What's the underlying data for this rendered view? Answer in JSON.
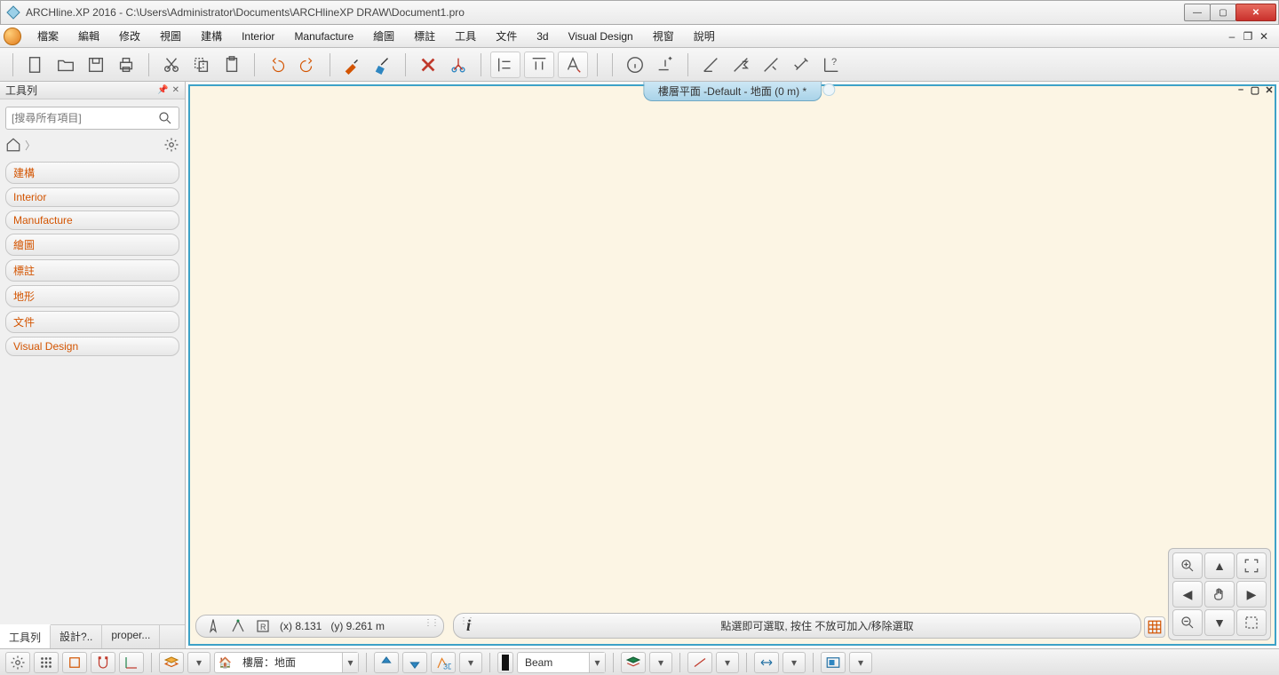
{
  "window": {
    "title": "ARCHline.XP 2016 - C:\\Users\\Administrator\\Documents\\ARCHlineXP DRAW\\Document1.pro"
  },
  "menu": {
    "items": [
      "檔案",
      "編輯",
      "修改",
      "視圖",
      "建構",
      "Interior",
      "Manufacture",
      "繪圖",
      "標註",
      "工具",
      "文件",
      "3d",
      "Visual Design",
      "視窗",
      "說明"
    ]
  },
  "sidebar": {
    "title": "工具列",
    "search_placeholder": "[搜尋所有項目]",
    "categories": [
      "建構",
      "Interior",
      "Manufacture",
      "繪圖",
      "標註",
      "地形",
      "文件",
      "Visual Design"
    ],
    "tabs": [
      "工具列",
      "設計?..",
      "proper..."
    ],
    "active_tab": 0
  },
  "canvas": {
    "tab_label": "樓層平面 -Default - 地面 (0 m) *"
  },
  "coords": {
    "x_label": "(x) 8.131",
    "y_label": "(y) 9.261 m"
  },
  "hint": "點選即可選取, 按住 不放可加入/移除選取",
  "status": {
    "layer_label": "樓層：地面",
    "layer_prefix": "🏠",
    "object_combo": "Beam"
  },
  "icons": {
    "search": "search-icon",
    "gear": "gear-icon",
    "home": "home-icon"
  }
}
